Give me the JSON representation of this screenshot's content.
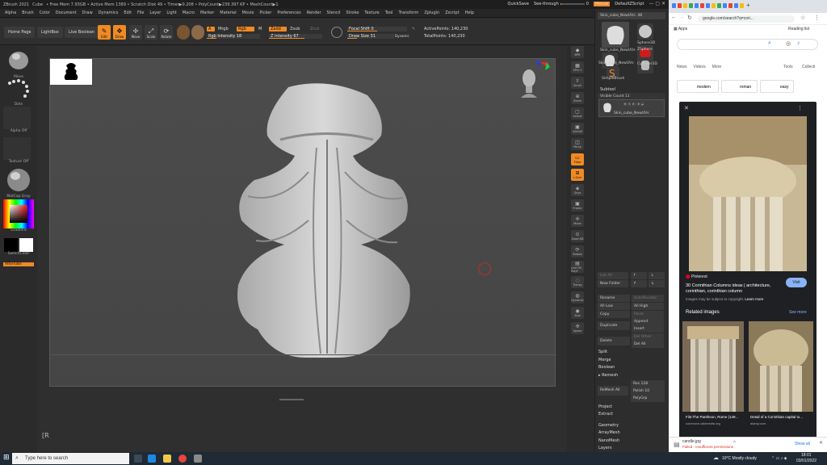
{
  "zbrush": {
    "title": "ZBrush 2021",
    "title_file": "Cube",
    "title_stats": "• Free Mem 7.93GB • Active Mem 1389 • Scratch Disk 49 • Timer▶0.208 • PolyCount▶239.397 KP • MeshCount▶1",
    "quicksave": "QuickSave",
    "see_through_label": "See-through",
    "see_through_value": "0",
    "see_through_level": 0,
    "menus_label": "Menus",
    "script_label": "DefaultZScript",
    "menus": [
      "Alpha",
      "Brush",
      "Color",
      "Document",
      "Draw",
      "Dynamics",
      "Edit",
      "File",
      "Layer",
      "Light",
      "Macro",
      "Marker",
      "Material",
      "Movie",
      "Picker",
      "Preferences",
      "Render",
      "Stencil",
      "Stroke",
      "Texture",
      "Tool",
      "Transform",
      "Zplugin",
      "Zscript",
      "Help"
    ],
    "toolbar": {
      "home": "Home Page",
      "lightbox": "LightBox",
      "live_boolean": "Live Boolean",
      "edit": "Edit",
      "draw": "Draw",
      "move": "Move",
      "scale": "Scale",
      "rotate": "Rotate",
      "a": "A",
      "mrgb": "Mrgb",
      "rgb": "Rgb",
      "m": "M",
      "zadd": "Zadd",
      "zsub": "Zsub",
      "zcut": "Zcut",
      "rgb_intensity": "Rgb Intensity 18",
      "z_intensity": "Z Intensity 67",
      "focal_shift": "Focal Shift 0",
      "draw_size": "Draw Size 31",
      "dynamic": "Dynamic",
      "active_points": "ActivePoints: 140,230",
      "total_points": "TotalPoints: 140,230"
    },
    "left_shelf": {
      "brush": "Move",
      "stroke": "Dots",
      "alpha": "Alpha Off",
      "texture": "Texture Off",
      "material": "MatCap Gray",
      "gradient": "Gradient",
      "switch_color": "SwitchColor",
      "alternate": "Alternate"
    },
    "right_shelf": [
      "BPR",
      "SPix 3",
      "Scroll",
      "Zoom",
      "Actual",
      "AAHalf",
      "Persp",
      "Floor",
      "L.Sym",
      "Qxyz",
      "Frame",
      "Move",
      "Zoom3D",
      "Rotate",
      "Line Fill PolyF",
      "Transp",
      "Dynamic",
      "Solo",
      "Xpose"
    ],
    "spix_value": "3",
    "tool": {
      "current": "Skin_cube_NewUVs. 48",
      "thumbs": [
        "Skin_cube_NewUVs",
        "Sphere3D",
        "Skin_cube_NewUVs",
        "ZSphere",
        "SimpleBrush",
        "Cylinder3D"
      ],
      "subtool_title": "Subtool",
      "visible_count": "Visible Count 11",
      "subtool_name": "Skin_cube_NewUVs",
      "list_all": "List All",
      "new_folder": "New Folder",
      "rename": "Rename",
      "autoreorder": "AutoReorder",
      "all_low": "All Low",
      "all_high": "All High",
      "copy": "Copy",
      "paste": "Paste",
      "append": "Append",
      "duplicate": "Duplicate",
      "insert": "Insert",
      "del_other": "Del Other",
      "delete": "Delete",
      "del_all": "Del All",
      "split": "Split",
      "merge": "Merge",
      "boolean": "Boolean",
      "remesh": "Remesh",
      "res": "Res 128",
      "polish": "Polish 10",
      "polygrp": "PolyGrp",
      "remesh_all": "ReMesh All",
      "project": "Project",
      "extract": "Extract",
      "geometry": "Geometry",
      "arraymesh": "ArrayMesh",
      "nanomesh": "NanoMesh",
      "layers": "Layers"
    },
    "canvas_note": "[R"
  },
  "browser": {
    "url": "google.com/search?q=cori...",
    "apps": "Apps",
    "reading_list": "Reading list",
    "tabs": [
      "News",
      "Videos",
      "More"
    ],
    "tools": "Tools",
    "collections": "Collecti",
    "chips": [
      "modern",
      "roman",
      "easy"
    ],
    "source": "Pinterest",
    "result_title": "30 Corinthian Columns ideas | architecture, corinthian, corinthian column",
    "copyright": "Images may be subject to copyright.",
    "learn_more": "Learn more",
    "visit": "Visit",
    "related": "Related images",
    "see_more": "See more",
    "related_items": [
      {
        "caption": "File:The Pantheon, Rome (149...",
        "source": "commons.wikimedia.org"
      },
      {
        "caption": "Detail of a Corinthian capital to...",
        "source": "alamy.com"
      }
    ],
    "download_name": "candle.jpg",
    "download_status": "Failed - Insufficient permissions",
    "show_all": "Show all"
  },
  "taskbar": {
    "search_placeholder": "Type here to search",
    "weather": "10°C  Mostly cloudy",
    "time": "18:01",
    "date": "03/01/2022"
  },
  "colors": {
    "accent": "#f08a24",
    "browser_blue": "#1a73e8"
  }
}
